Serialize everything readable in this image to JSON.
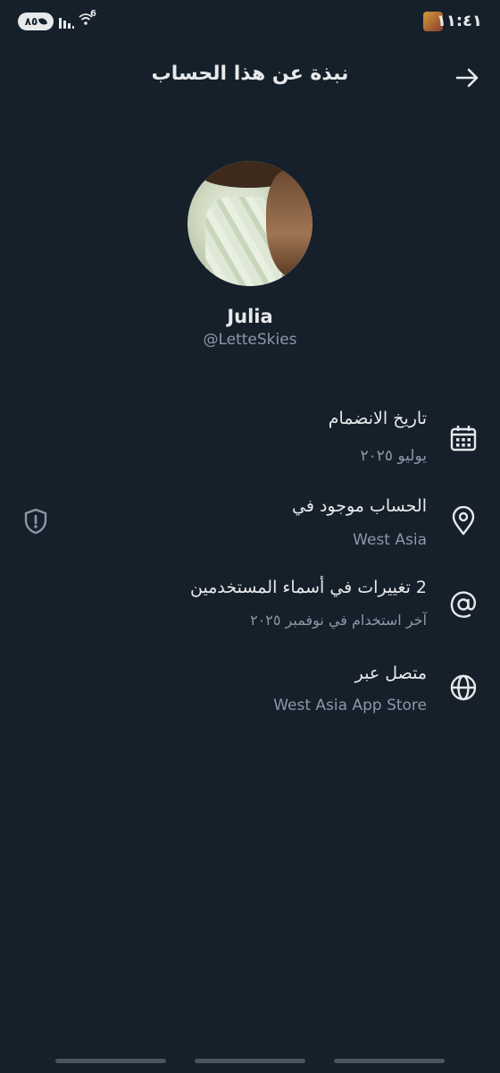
{
  "status_bar": {
    "battery": "٨٥",
    "network": "6",
    "clock": "١١:٤١"
  },
  "header": {
    "title": "نبذة عن هذا الحساب",
    "back_icon": "arrow-right-icon"
  },
  "profile": {
    "name": "Julia",
    "handle": "@LetteSkies"
  },
  "info": [
    {
      "icon": "calendar-icon",
      "title": "تاريخ الانضمام",
      "subtitle": "يوليو ٢٠٢٥"
    },
    {
      "icon": "location-pin-icon",
      "title": "الحساب موجود في",
      "subtitle": "West Asia",
      "badge_icon": "shield-alert-icon"
    },
    {
      "icon": "at-sign-icon",
      "title": "2 تغييرات في أسماء المستخدمين",
      "subtitle": "آخر استخدام في نوفمبر ٢٠٢٥"
    },
    {
      "icon": "globe-icon",
      "title": "متصل عبر",
      "subtitle": "West Asia App Store"
    }
  ],
  "colors": {
    "background": "#15202b",
    "primary_text": "#e7e9ea",
    "secondary_text": "#8b98a5"
  }
}
